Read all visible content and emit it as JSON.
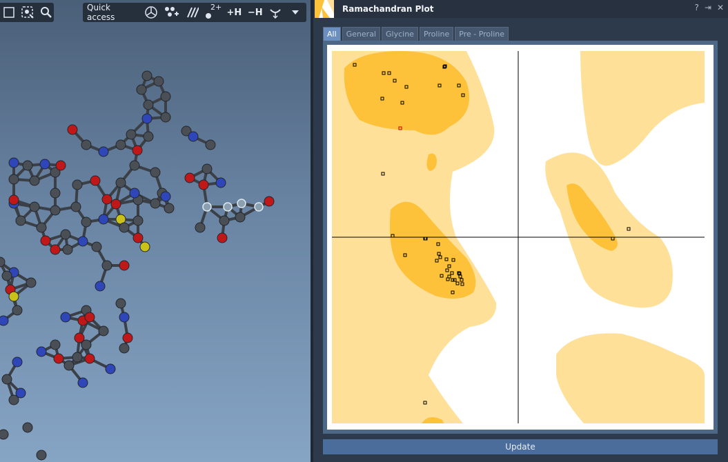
{
  "toolbar": {
    "quick_access_label": "Quick access",
    "add_h_label": "+H",
    "remove_h_label": "−H",
    "charge_label": "2+",
    "icons": [
      "select-icon",
      "add-fragment-icon",
      "zoom-icon",
      "ring-icon",
      "atoms-add-icon",
      "bonds-icon",
      "charge-icon",
      "add-hydrogen-icon",
      "remove-hydrogen-icon",
      "flip-icon",
      "dropdown-icon"
    ]
  },
  "panel": {
    "title": "Ramachandran Plot",
    "help": "?",
    "pin": "⇥",
    "close": "✕",
    "tabs": [
      {
        "label": "All",
        "active": true
      },
      {
        "label": "General",
        "active": false
      },
      {
        "label": "Glycine",
        "active": false
      },
      {
        "label": "Proline",
        "active": false
      },
      {
        "label": "Pre - Proline",
        "active": false
      }
    ],
    "update_label": "Update"
  },
  "colors": {
    "favored": "#fdc23a",
    "allowed": "#ffe099",
    "point": "#000000",
    "outlier_point": "#d00000"
  }
}
